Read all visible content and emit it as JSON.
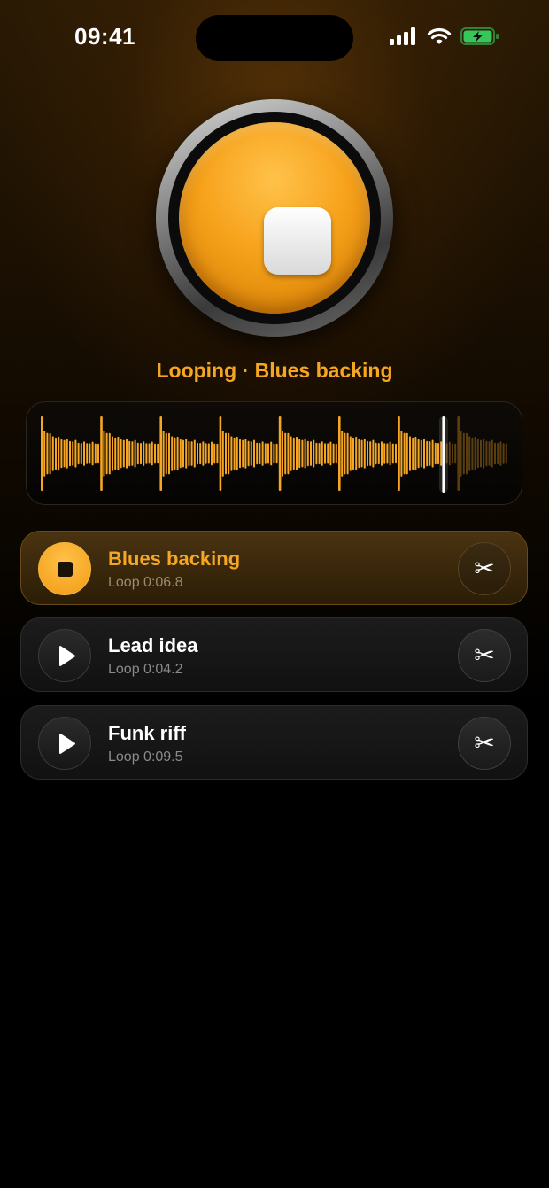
{
  "status_bar": {
    "time": "09:41"
  },
  "now_playing": {
    "text": "Looping · Blues backing",
    "state": "playing",
    "playhead_fraction": 0.86
  },
  "waveform": {
    "accent_color": "#f5a623"
  },
  "loops": [
    {
      "title": "Blues backing",
      "subtitle": "Loop 0:06.8",
      "active": true,
      "control_icon": "stop-icon"
    },
    {
      "title": "Lead idea",
      "subtitle": "Loop 0:04.2",
      "active": false,
      "control_icon": "play-icon"
    },
    {
      "title": "Funk riff",
      "subtitle": "Loop 0:09.5",
      "active": false,
      "control_icon": "play-icon"
    }
  ],
  "icons": {
    "trim": "✂"
  },
  "colors": {
    "accent": "#f5a623",
    "background": "#000000"
  }
}
